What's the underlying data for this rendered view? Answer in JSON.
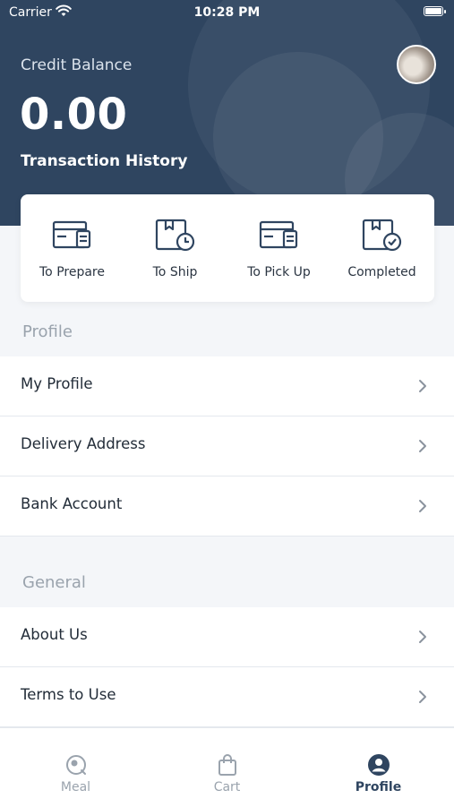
{
  "status_bar": {
    "carrier": "Carrier",
    "time": "10:28 PM"
  },
  "header": {
    "credit_label": "Credit Balance",
    "credit_value": "0.00",
    "transaction_history": "Transaction History"
  },
  "orders": [
    {
      "label": "To Prepare",
      "icon": "prepare-icon"
    },
    {
      "label": "To Ship",
      "icon": "ship-icon"
    },
    {
      "label": "To Pick Up",
      "icon": "pickup-icon"
    },
    {
      "label": "Completed",
      "icon": "completed-icon"
    }
  ],
  "profile_section": {
    "title": "Profile",
    "items": [
      {
        "label": "My Profile"
      },
      {
        "label": "Delivery Address"
      },
      {
        "label": "Bank Account"
      }
    ]
  },
  "general_section": {
    "title": "General",
    "items": [
      {
        "label": "About Us"
      },
      {
        "label": "Terms to Use"
      }
    ]
  },
  "tabbar": {
    "active": "Profile",
    "tabs": [
      {
        "label": "Meal",
        "icon": "meal-icon"
      },
      {
        "label": "Cart",
        "icon": "cart-icon"
      },
      {
        "label": "Profile",
        "icon": "profile-icon"
      }
    ]
  },
  "colors": {
    "header_bg": "#2f4560",
    "accent": "#2f4560",
    "muted": "#9aa3ad"
  }
}
